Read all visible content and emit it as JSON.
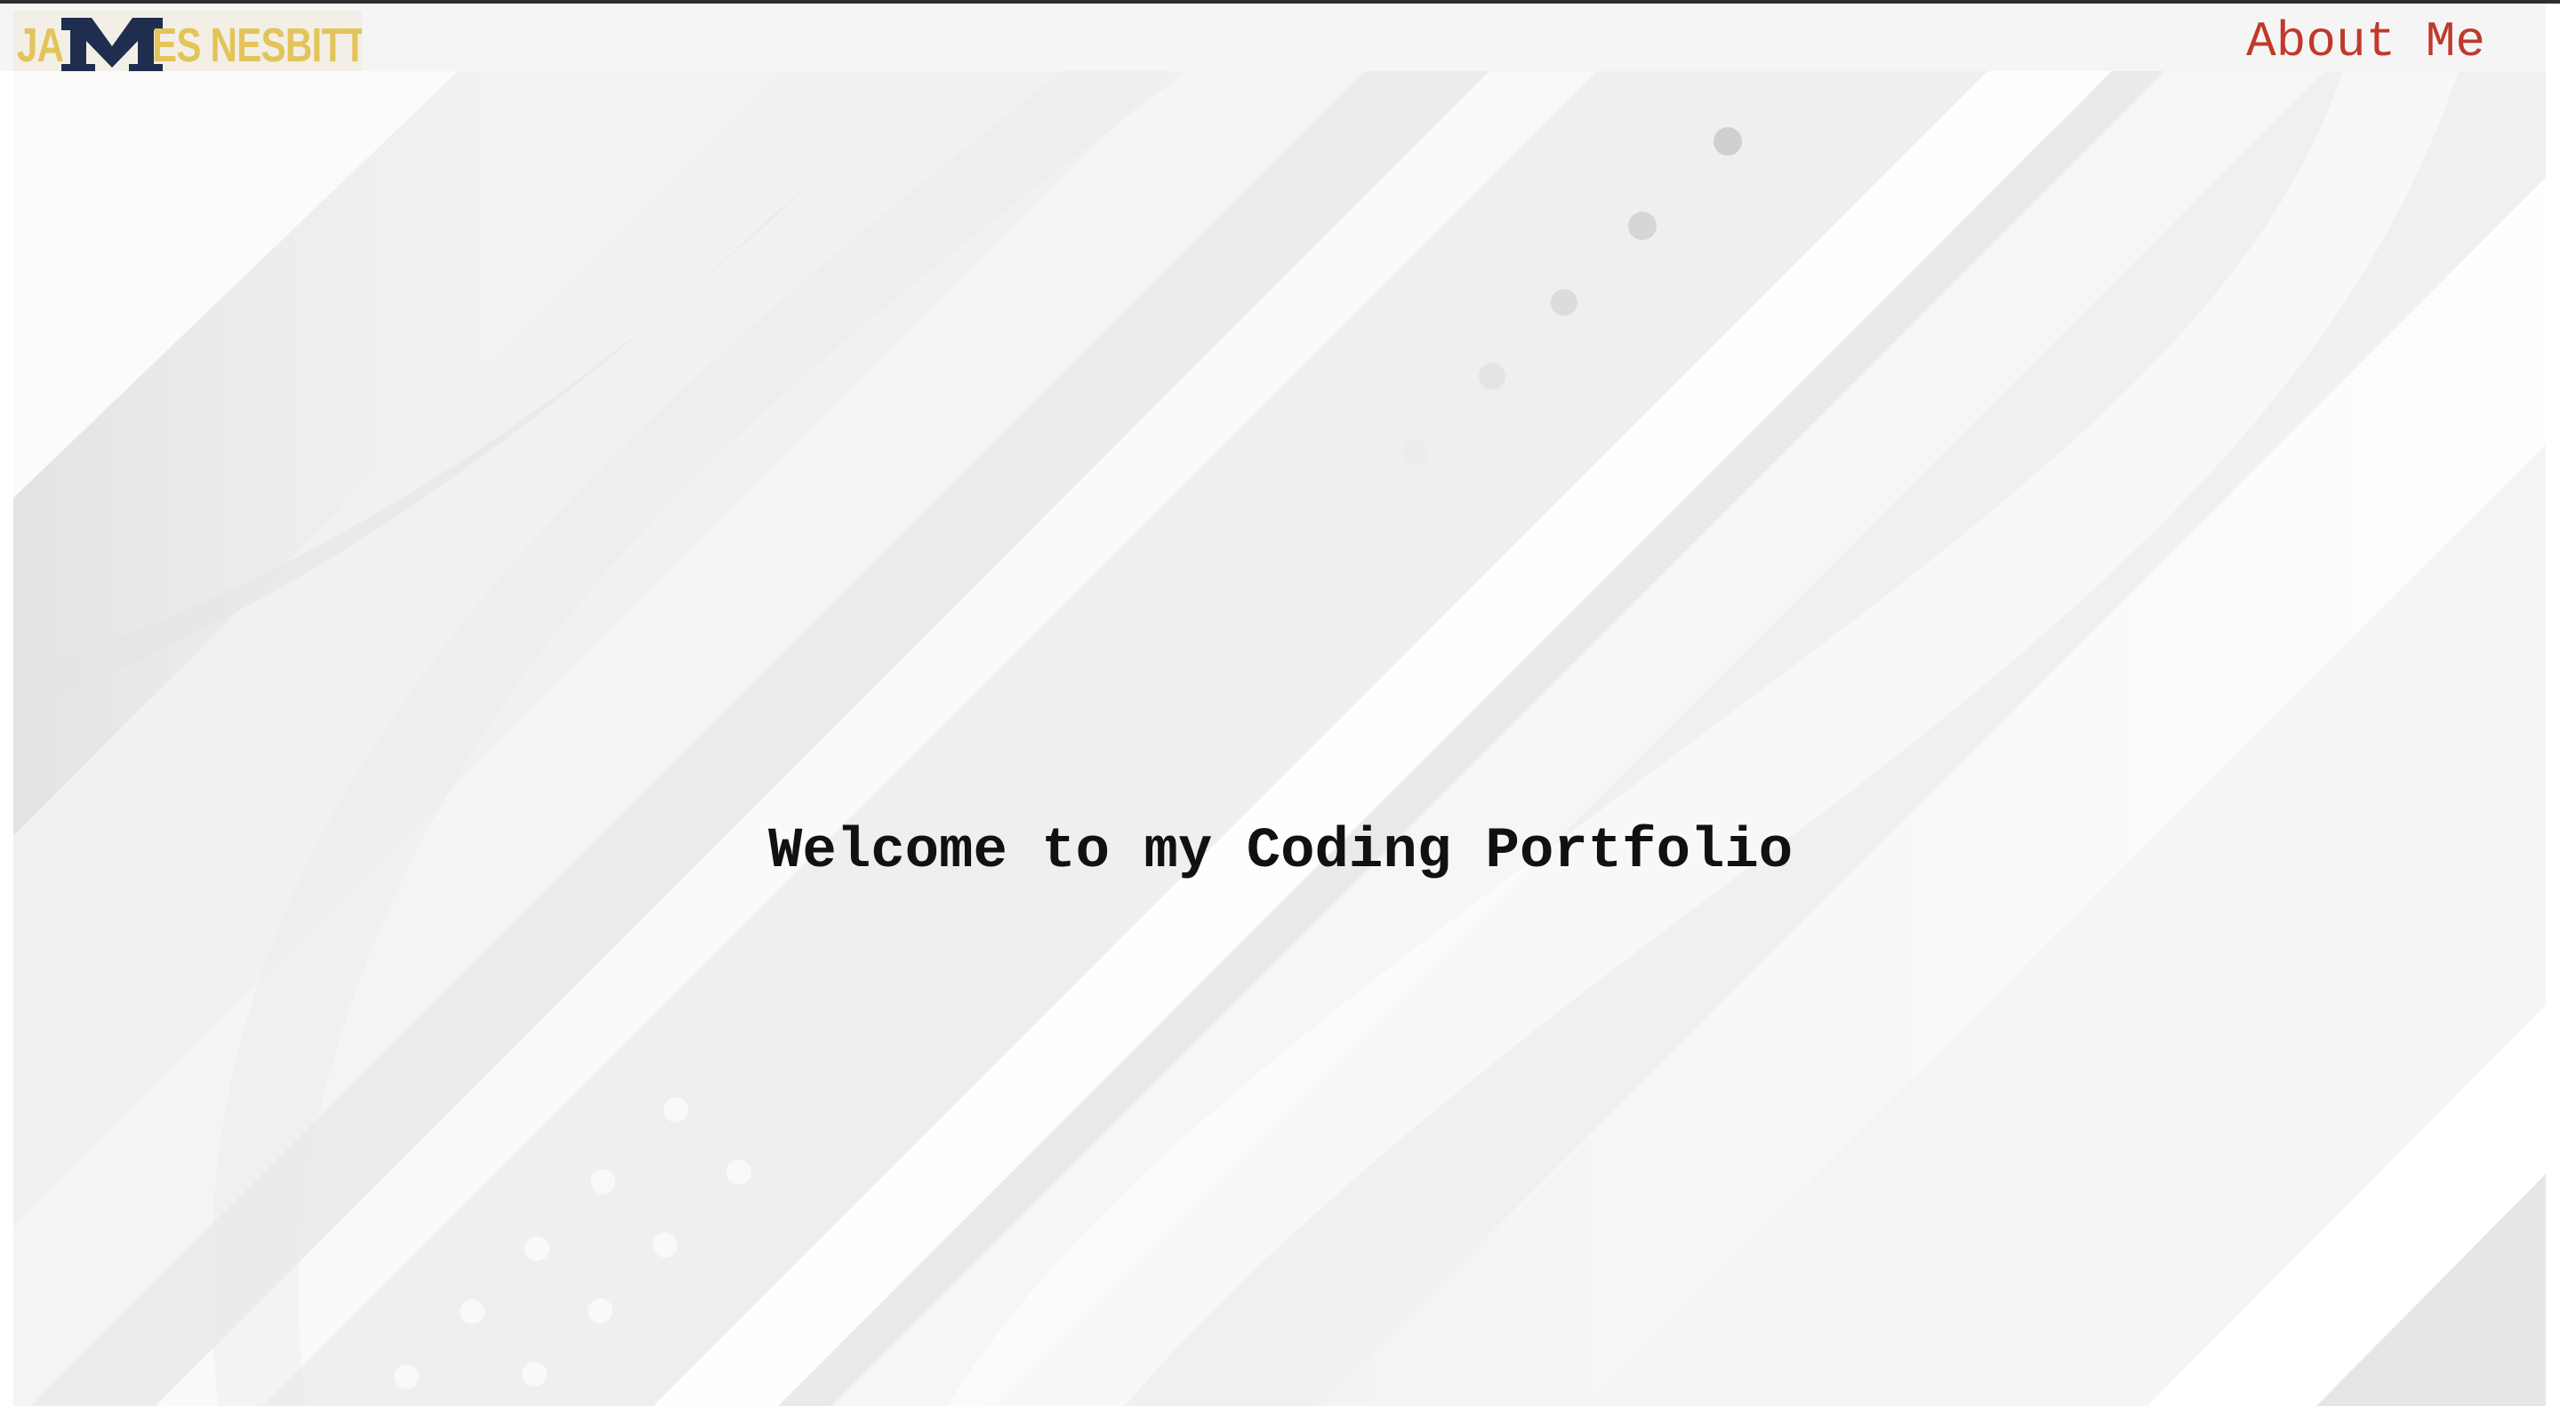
{
  "header": {
    "logo": {
      "prefix": "JA",
      "monogram": "M",
      "suffix": "ES NESBITT",
      "gold_color": "#e3c45a",
      "navy_color": "#1f2d4f"
    },
    "nav": {
      "about_label": "About Me",
      "link_color": "#c0392b"
    }
  },
  "hero": {
    "title": "Welcome to my Coding Portfolio",
    "background_color": "#f4f4f4"
  }
}
